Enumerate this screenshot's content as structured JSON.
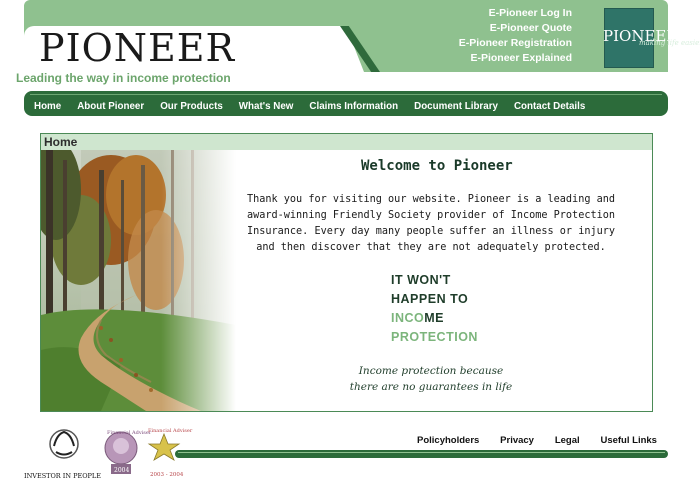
{
  "brand": {
    "name": "PIONEER",
    "tagline": "Leading the way in income protection"
  },
  "header_links": [
    {
      "label": "E-Pioneer Log In"
    },
    {
      "label": "E-Pioneer Quote"
    },
    {
      "label": "E-Pioneer Registration"
    },
    {
      "label": "E-Pioneer Explained"
    }
  ],
  "logo_badge": {
    "text": "PIONEER",
    "script": "making life easier"
  },
  "nav": [
    {
      "label": "Home"
    },
    {
      "label": "About Pioneer"
    },
    {
      "label": "Our Products"
    },
    {
      "label": "What's New"
    },
    {
      "label": "Claims Information"
    },
    {
      "label": "Document Library"
    },
    {
      "label": "Contact Details"
    }
  ],
  "main": {
    "section_title": "Home",
    "welcome": "Welcome to Pioneer",
    "intro": "Thank you for visiting our website. Pioneer is a leading and award-winning Friendly Society provider of Income Protection Insurance. Every day many people suffer an illness or injury and then discover that they are not adequately protected.",
    "slogan_line1": "IT WON'T",
    "slogan_line2": "HAPPEN TO",
    "slogan_line3a": "INCO",
    "slogan_line3b": "ME",
    "slogan_line4": "PROTECTION",
    "motto_line1": "Income protection because",
    "motto_line2": "there are no guarantees in life"
  },
  "footer": {
    "badges": {
      "investor": "INVESTOR IN PEOPLE",
      "adviser1_top": "Financial Adviser",
      "adviser1_year": "2004",
      "adviser2_top": "Financial Adviser",
      "adviser2_year": "2003 - 2004"
    },
    "links": [
      {
        "label": "Policyholders"
      },
      {
        "label": "Privacy"
      },
      {
        "label": "Legal"
      },
      {
        "label": "Useful Links"
      }
    ]
  },
  "colors": {
    "header_green": "#8fc18f",
    "nav_green": "#2c6b3a",
    "accent_green": "#7cb57c"
  }
}
